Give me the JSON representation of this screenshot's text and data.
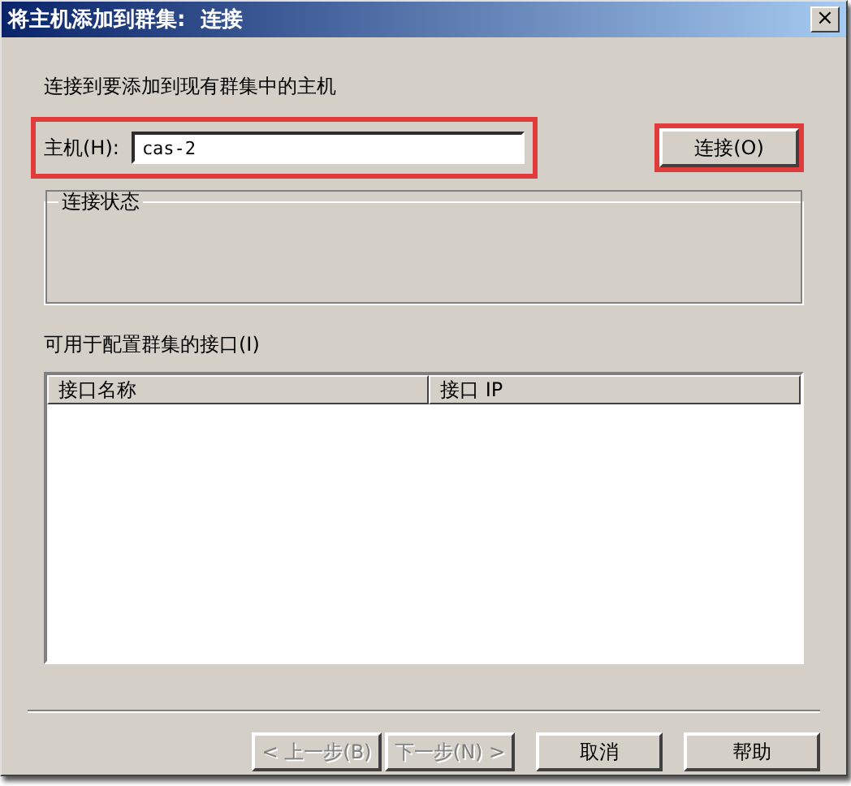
{
  "window": {
    "title": "将主机添加到群集:  连接",
    "close": "×"
  },
  "intro": "连接到要添加到现有群集中的主机",
  "host": {
    "label": "主机(H):",
    "value": "cas-2",
    "highlighted": true
  },
  "connect_button": {
    "label": "连接(O)",
    "highlighted": true
  },
  "status_group": {
    "legend": "连接状态"
  },
  "interfaces": {
    "label": "可用于配置群集的接口(I)",
    "columns": [
      "接口名称",
      "接口 IP"
    ]
  },
  "buttons": [
    {
      "label": "< 上一步(B)",
      "disabled": true
    },
    {
      "label": "下一步(N) >",
      "disabled": true
    },
    {
      "label": "取消",
      "disabled": false
    },
    {
      "label": "帮助",
      "disabled": false
    }
  ]
}
